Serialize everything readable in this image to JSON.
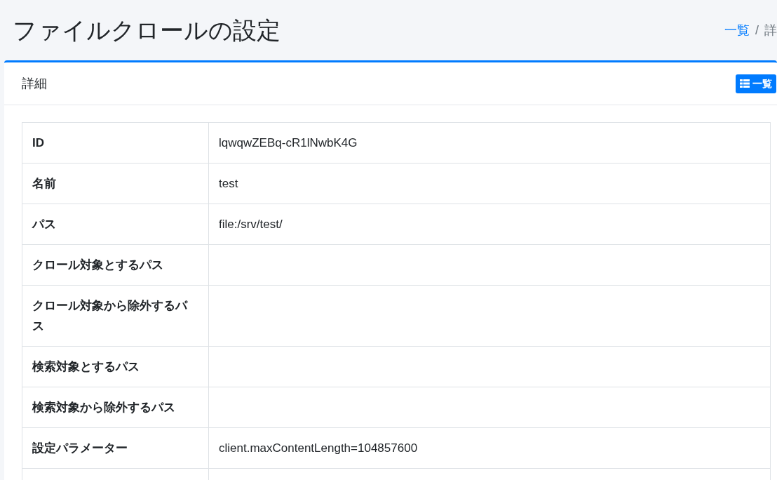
{
  "page_title": "ファイルクロールの設定",
  "breadcrumb": [
    {
      "label": "一覧",
      "link": true
    },
    {
      "label": "詳",
      "link": false
    }
  ],
  "breadcrumb_separator": "/",
  "card": {
    "title": "詳細",
    "list_button": "一覧"
  },
  "details": [
    {
      "label": "ID",
      "value": "lqwqwZEBq-cR1lNwbK4G"
    },
    {
      "label": "名前",
      "value": "test"
    },
    {
      "label": "パス",
      "value": "file:/srv/test/"
    },
    {
      "label": "クロール対象とするパス"
    },
    {
      "label": "クロール対象から除外するパス"
    },
    {
      "label": "検索対象とするパス"
    },
    {
      "label": "検索対象から除外するパス"
    },
    {
      "label": "設定パラメーター",
      "value": "client.maxContentLength=104857600"
    }
  ]
}
